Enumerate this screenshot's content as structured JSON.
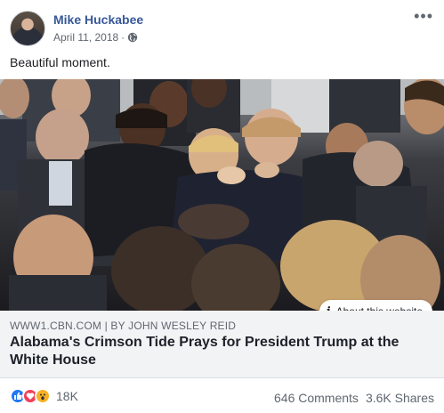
{
  "post": {
    "author": "Mike Huckabee",
    "date": "April 11, 2018",
    "separator": "·",
    "text": "Beautiful moment."
  },
  "icons": {
    "avatar": "profile-photo",
    "privacy": "globe-icon",
    "more": "ellipsis-icon",
    "info": "info-icon",
    "reactions": [
      "like-icon",
      "love-icon",
      "wow-icon"
    ]
  },
  "link_preview": {
    "source": "WWW1.CBN.COM | BY JOHN WESLEY REID",
    "title": "Alabama's Crimson Tide Prays for President Trump at the White House",
    "about_label": "About this website",
    "info_glyph": "i"
  },
  "footer": {
    "reaction_count": "18K",
    "comments": "646 Comments",
    "shares": "3.6K Shares"
  },
  "colors": {
    "author_link": "#385898",
    "like": "#2078f4",
    "love": "#f33e58",
    "wow": "#f7b125",
    "link_box_bg": "#f2f3f5"
  }
}
